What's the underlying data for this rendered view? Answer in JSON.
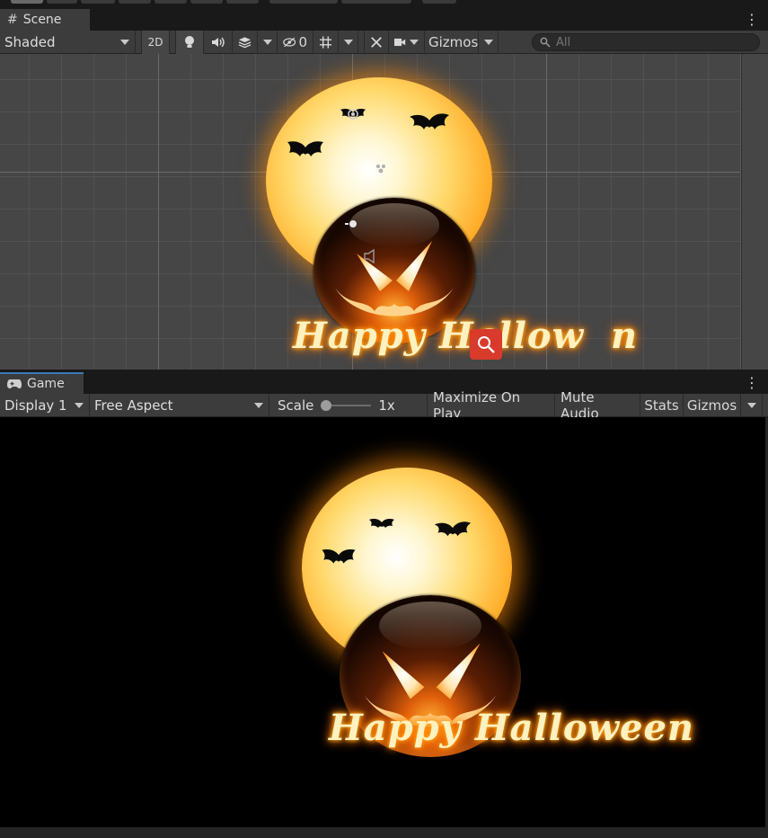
{
  "scene_panel": {
    "tab_label": "Scene",
    "toolbar": {
      "draw_mode": "Shaded",
      "two_d_label": "2D",
      "hidden_count": "0",
      "gizmos_label": "Gizmos",
      "search_placeholder": "All"
    }
  },
  "game_panel": {
    "tab_label": "Game",
    "toolbar": {
      "display": "Display 1",
      "aspect": "Free Aspect",
      "scale_label": "Scale",
      "scale_value": "1x",
      "maximize_on_play": "Maximize On Play",
      "mute_audio": "Mute Audio",
      "stats": "Stats",
      "gizmos_label": "Gizmos"
    }
  },
  "artwork": {
    "greeting_scene": "Happy Hallow",
    "greeting_scene_tail": "n",
    "greeting_game": "Happy Halloween"
  },
  "colors": {
    "accent": "#3a79bb",
    "panel_bg": "#3c3c3c",
    "scene_bg": "#464646",
    "game_bg": "#000000"
  }
}
